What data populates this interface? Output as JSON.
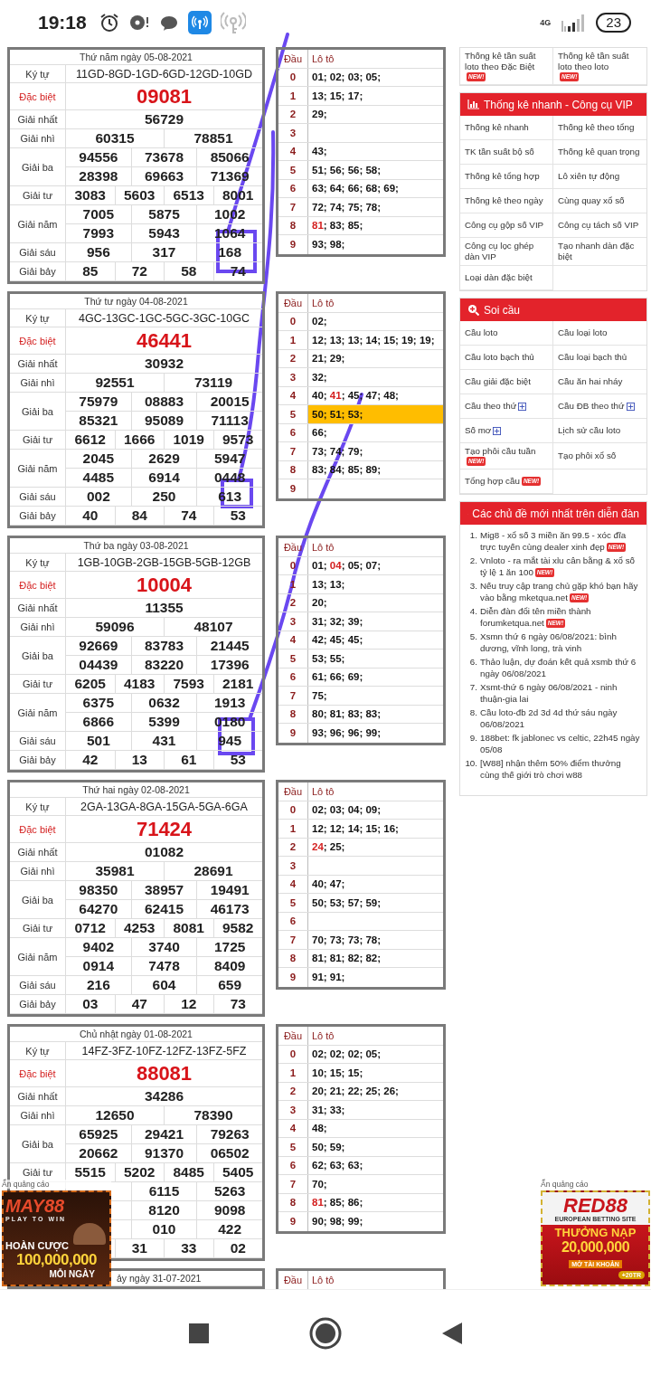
{
  "status_bar": {
    "time": "19:18",
    "network": "4G",
    "battery": "23"
  },
  "results": [
    {
      "date": "Thứ năm ngày 05-08-2021",
      "prizes": [
        {
          "kind": "code",
          "label": "Ký tự",
          "lines": [
            [
              "11GD-8GD-1GD-6GD-12GD-10GD"
            ]
          ]
        },
        {
          "kind": "special",
          "label": "Đặc biệt",
          "lines": [
            [
              "09081"
            ]
          ]
        },
        {
          "kind": "normal",
          "label": "Giải nhất",
          "lines": [
            [
              "56729"
            ]
          ]
        },
        {
          "kind": "normal",
          "label": "Giải nhì",
          "lines": [
            [
              "60315",
              "78851"
            ]
          ]
        },
        {
          "kind": "normal",
          "label": "Giải ba",
          "lines": [
            [
              "94556",
              "73678",
              "85066"
            ],
            [
              "28398",
              "69663",
              "71369"
            ]
          ]
        },
        {
          "kind": "normal",
          "label": "Giải tư",
          "lines": [
            [
              "3083",
              "5603",
              "6513",
              "8001"
            ]
          ]
        },
        {
          "kind": "normal",
          "label": "Giải năm",
          "lines": [
            [
              "7005",
              "5875",
              "1002"
            ],
            [
              "7993",
              "5943",
              "1064"
            ]
          ]
        },
        {
          "kind": "normal",
          "label": "Giải sáu",
          "lines": [
            [
              "956",
              "317",
              "168"
            ]
          ]
        },
        {
          "kind": "normal",
          "label": "Giải bảy",
          "lines": [
            [
              "85",
              "72",
              "58",
              "74"
            ]
          ]
        }
      ],
      "loto": {
        "columns": [
          "Đầu",
          "Lô tô"
        ],
        "rows": [
          {
            "head": "0",
            "text": "01; 02; 03; 05;",
            "highlighted": false
          },
          {
            "head": "1",
            "text": "13; 15; 17;",
            "highlighted": false
          },
          {
            "head": "2",
            "text": "29;",
            "highlighted": false
          },
          {
            "head": "3",
            "highlighted": false
          },
          {
            "head": "4",
            "text": "43;",
            "highlighted": false
          },
          {
            "head": "5",
            "text": "51; 56; 56; 58;",
            "highlighted": false
          },
          {
            "head": "6",
            "text": "63; 64; 66; 68; 69;",
            "highlighted": false
          },
          {
            "head": "7",
            "text": "72; 74; 75; 78;",
            "highlighted": false
          },
          {
            "head": "8",
            "segments": [
              {
                "text": "81",
                "special": true
              },
              {
                "text": "; 83; 85;",
                "special": false
              }
            ],
            "highlighted": false
          },
          {
            "head": "9",
            "text": "93; 98;",
            "highlighted": false
          }
        ]
      }
    },
    {
      "date": "Thứ tư ngày 04-08-2021",
      "prizes": [
        {
          "kind": "code",
          "label": "Ký tự",
          "lines": [
            [
              "4GC-13GC-1GC-5GC-3GC-10GC"
            ]
          ]
        },
        {
          "kind": "special",
          "label": "Đặc biệt",
          "lines": [
            [
              "46441"
            ]
          ]
        },
        {
          "kind": "normal",
          "label": "Giải nhất",
          "lines": [
            [
              "30932"
            ]
          ]
        },
        {
          "kind": "normal",
          "label": "Giải nhì",
          "lines": [
            [
              "92551",
              "73119"
            ]
          ]
        },
        {
          "kind": "normal",
          "label": "Giải ba",
          "lines": [
            [
              "75979",
              "08883",
              "20015"
            ],
            [
              "85321",
              "95089",
              "71113"
            ]
          ]
        },
        {
          "kind": "normal",
          "label": "Giải tư",
          "lines": [
            [
              "6612",
              "1666",
              "1019",
              "9573"
            ]
          ]
        },
        {
          "kind": "normal",
          "label": "Giải năm",
          "lines": [
            [
              "2045",
              "2629",
              "5947"
            ],
            [
              "4485",
              "6914",
              "0448"
            ]
          ]
        },
        {
          "kind": "normal",
          "label": "Giải sáu",
          "lines": [
            [
              "002",
              "250",
              "613"
            ]
          ]
        },
        {
          "kind": "normal",
          "label": "Giải bảy",
          "lines": [
            [
              "40",
              "84",
              "74",
              "53"
            ]
          ]
        }
      ],
      "loto": {
        "columns": [
          "Đầu",
          "Lô tô"
        ],
        "rows": [
          {
            "head": "0",
            "text": "02;",
            "highlighted": false
          },
          {
            "head": "1",
            "text": "12; 13; 13; 14; 15; 19; 19;",
            "highlighted": false
          },
          {
            "head": "2",
            "text": "21; 29;",
            "highlighted": false
          },
          {
            "head": "3",
            "text": "32;",
            "highlighted": false
          },
          {
            "head": "4",
            "segments": [
              {
                "text": "40; ",
                "special": false
              },
              {
                "text": "41",
                "special": true
              },
              {
                "text": "; 45; 47; 48;",
                "special": false
              }
            ],
            "highlighted": false
          },
          {
            "head": "5",
            "text": "50; 51; 53;",
            "highlighted": true
          },
          {
            "head": "6",
            "text": "66;",
            "highlighted": false
          },
          {
            "head": "7",
            "text": "73; 74; 79;",
            "highlighted": false
          },
          {
            "head": "8",
            "text": "83; 84; 85; 89;",
            "highlighted": false
          },
          {
            "head": "9",
            "highlighted": false
          }
        ]
      }
    },
    {
      "date": "Thứ ba ngày 03-08-2021",
      "prizes": [
        {
          "kind": "code",
          "label": "Ký tự",
          "lines": [
            [
              "1GB-10GB-2GB-15GB-5GB-12GB"
            ]
          ]
        },
        {
          "kind": "special",
          "label": "Đặc biệt",
          "lines": [
            [
              "10004"
            ]
          ]
        },
        {
          "kind": "normal",
          "label": "Giải nhất",
          "lines": [
            [
              "11355"
            ]
          ]
        },
        {
          "kind": "normal",
          "label": "Giải nhì",
          "lines": [
            [
              "59096",
              "48107"
            ]
          ]
        },
        {
          "kind": "normal",
          "label": "Giải ba",
          "lines": [
            [
              "92669",
              "83783",
              "21445"
            ],
            [
              "04439",
              "83220",
              "17396"
            ]
          ]
        },
        {
          "kind": "normal",
          "label": "Giải tư",
          "lines": [
            [
              "6205",
              "4183",
              "7593",
              "2181"
            ]
          ]
        },
        {
          "kind": "normal",
          "label": "Giải năm",
          "lines": [
            [
              "6375",
              "0632",
              "1913"
            ],
            [
              "6866",
              "5399",
              "0180"
            ]
          ]
        },
        {
          "kind": "normal",
          "label": "Giải sáu",
          "lines": [
            [
              "501",
              "431",
              "945"
            ]
          ]
        },
        {
          "kind": "normal",
          "label": "Giải bảy",
          "lines": [
            [
              "42",
              "13",
              "61",
              "53"
            ]
          ]
        }
      ],
      "loto": {
        "columns": [
          "Đầu",
          "Lô tô"
        ],
        "rows": [
          {
            "head": "0",
            "segments": [
              {
                "text": "01; ",
                "special": false
              },
              {
                "text": "04",
                "special": true
              },
              {
                "text": "; 05; 07;",
                "special": false
              }
            ],
            "highlighted": false
          },
          {
            "head": "1",
            "text": "13; 13;",
            "highlighted": false
          },
          {
            "head": "2",
            "text": "20;",
            "highlighted": false
          },
          {
            "head": "3",
            "text": "31; 32; 39;",
            "highlighted": false
          },
          {
            "head": "4",
            "text": "42; 45; 45;",
            "highlighted": false
          },
          {
            "head": "5",
            "text": "53; 55;",
            "highlighted": false
          },
          {
            "head": "6",
            "text": "61; 66; 69;",
            "highlighted": false
          },
          {
            "head": "7",
            "text": "75;",
            "highlighted": false
          },
          {
            "head": "8",
            "text": "80; 81; 83; 83;",
            "highlighted": false
          },
          {
            "head": "9",
            "text": "93; 96; 96; 99;",
            "highlighted": false
          }
        ]
      }
    },
    {
      "date": "Thứ hai ngày 02-08-2021",
      "prizes": [
        {
          "kind": "code",
          "label": "Ký tự",
          "lines": [
            [
              "2GA-13GA-8GA-15GA-5GA-6GA"
            ]
          ]
        },
        {
          "kind": "special",
          "label": "Đặc biệt",
          "lines": [
            [
              "71424"
            ]
          ]
        },
        {
          "kind": "normal",
          "label": "Giải nhất",
          "lines": [
            [
              "01082"
            ]
          ]
        },
        {
          "kind": "normal",
          "label": "Giải nhì",
          "lines": [
            [
              "35981",
              "28691"
            ]
          ]
        },
        {
          "kind": "normal",
          "label": "Giải ba",
          "lines": [
            [
              "98350",
              "38957",
              "19491"
            ],
            [
              "64270",
              "62415",
              "46173"
            ]
          ]
        },
        {
          "kind": "normal",
          "label": "Giải tư",
          "lines": [
            [
              "0712",
              "4253",
              "8081",
              "9582"
            ]
          ]
        },
        {
          "kind": "normal",
          "label": "Giải năm",
          "lines": [
            [
              "9402",
              "3740",
              "1725"
            ],
            [
              "0914",
              "7478",
              "8409"
            ]
          ]
        },
        {
          "kind": "normal",
          "label": "Giải sáu",
          "lines": [
            [
              "216",
              "604",
              "659"
            ]
          ]
        },
        {
          "kind": "normal",
          "label": "Giải bảy",
          "lines": [
            [
              "03",
              "47",
              "12",
              "73"
            ]
          ]
        }
      ],
      "loto": {
        "columns": [
          "Đầu",
          "Lô tô"
        ],
        "rows": [
          {
            "head": "0",
            "text": "02; 03; 04; 09;",
            "highlighted": false
          },
          {
            "head": "1",
            "text": "12; 12; 14; 15; 16;",
            "highlighted": false
          },
          {
            "head": "2",
            "segments": [
              {
                "text": "24",
                "special": true
              },
              {
                "text": "; 25;",
                "special": false
              }
            ],
            "highlighted": false
          },
          {
            "head": "3",
            "highlighted": false
          },
          {
            "head": "4",
            "text": "40; 47;",
            "highlighted": false
          },
          {
            "head": "5",
            "text": "50; 53; 57; 59;",
            "highlighted": false
          },
          {
            "head": "6",
            "highlighted": false
          },
          {
            "head": "7",
            "text": "70; 73; 73; 78;",
            "highlighted": false
          },
          {
            "head": "8",
            "text": "81; 81; 82; 82;",
            "highlighted": false
          },
          {
            "head": "9",
            "text": "91; 91;",
            "highlighted": false
          }
        ]
      }
    },
    {
      "date": "Chủ nhật ngày 01-08-2021",
      "prizes": [
        {
          "kind": "code",
          "label": "Ký tự",
          "lines": [
            [
              "14FZ-3FZ-10FZ-12FZ-13FZ-5FZ"
            ]
          ]
        },
        {
          "kind": "special",
          "label": "Đặc biệt",
          "lines": [
            [
              "88081"
            ]
          ]
        },
        {
          "kind": "normal",
          "label": "Giải nhất",
          "lines": [
            [
              "34286"
            ]
          ]
        },
        {
          "kind": "normal",
          "label": "Giải nhì",
          "lines": [
            [
              "12650",
              "78390"
            ]
          ]
        },
        {
          "kind": "normal",
          "label": "Giải ba",
          "lines": [
            [
              "65925",
              "29421",
              "79263"
            ],
            [
              "20662",
              "91370",
              "06502"
            ]
          ]
        },
        {
          "kind": "normal",
          "label": "Giải tư",
          "lines": [
            [
              "5515",
              "5202",
              "8485",
              "5405"
            ]
          ]
        },
        {
          "kind": "normal",
          "lines": [
            [
              "6115",
              "5263"
            ],
            [
              "8120",
              "9098"
            ]
          ],
          "leading_blank": true
        },
        {
          "kind": "normal",
          "lines": [
            [
              "010",
              "422"
            ]
          ],
          "leading_blank": true
        },
        {
          "kind": "normal",
          "lines": [
            [
              "31",
              "33",
              "02"
            ]
          ],
          "leading_blank": true
        }
      ],
      "loto": {
        "columns": [
          "Đầu",
          "Lô tô"
        ],
        "rows": [
          {
            "head": "0",
            "text": "02; 02; 02; 05;",
            "highlighted": false
          },
          {
            "head": "1",
            "text": "10; 15; 15;",
            "highlighted": false
          },
          {
            "head": "2",
            "text": "20; 21; 22; 25; 26;",
            "highlighted": false
          },
          {
            "head": "3",
            "text": "31; 33;",
            "highlighted": false
          },
          {
            "head": "4",
            "text": "48;",
            "highlighted": false
          },
          {
            "head": "5",
            "text": "50; 59;",
            "highlighted": false
          },
          {
            "head": "6",
            "text": "62; 63; 63;",
            "highlighted": false
          },
          {
            "head": "7",
            "text": "70;",
            "highlighted": false
          },
          {
            "head": "8",
            "segments": [
              {
                "text": "81",
                "special": true
              },
              {
                "text": "; 85; 86;",
                "special": false
              }
            ],
            "highlighted": false
          },
          {
            "head": "9",
            "text": "90; 98; 99;",
            "highlighted": false
          }
        ]
      }
    },
    {
      "date": "ảy ngày 31-07-2021",
      "loto": {
        "columns": [
          "Đầu",
          "Lô tô"
        ]
      }
    }
  ],
  "sidebar": {
    "top_links": [
      {
        "text": "Thống kê tần suất loto theo Đặc Biệt",
        "badge": "NEW!",
        "expandable": false
      },
      {
        "text": "Thống kê tần suất loto theo loto",
        "badge": "NEW!",
        "expandable": false
      }
    ],
    "sections": [
      {
        "kind": "stats",
        "title": "Thống kê nhanh - Công cụ VIP",
        "items": [
          {
            "text": "Thống kê nhanh",
            "expandable": false
          },
          {
            "text": "Thống kê theo tổng",
            "expandable": false
          },
          {
            "text": "TK tần suất bộ số",
            "expandable": false
          },
          {
            "text": "Thống kê quan trọng",
            "expandable": false
          },
          {
            "text": "Thống kê tổng hợp",
            "expandable": false
          },
          {
            "text": "Lô xiên tự động",
            "expandable": false
          },
          {
            "text": "Thống kê theo ngày",
            "expandable": false
          },
          {
            "text": "Cùng quay xổ số",
            "expandable": false
          },
          {
            "text": "Công cụ gộp số VIP",
            "expandable": false
          },
          {
            "text": "Công cụ tách số VIP",
            "expandable": false
          },
          {
            "text": "Công cụ lọc ghép dàn VIP",
            "expandable": false
          },
          {
            "text": "Tạo nhanh dàn đặc biệt",
            "expandable": false
          },
          {
            "text": "Loại dàn đặc biệt",
            "expandable": false
          }
        ]
      },
      {
        "kind": "bridge",
        "title": "Soi cầu",
        "items": [
          {
            "text": "Cầu loto",
            "expandable": false
          },
          {
            "text": "Cầu loại loto",
            "expandable": false
          },
          {
            "text": "Cầu loto bạch thủ",
            "expandable": false
          },
          {
            "text": "Cầu loại bạch thủ",
            "expandable": false
          },
          {
            "text": "Cầu giải đặc biệt",
            "expandable": false
          },
          {
            "text": "Cầu ăn hai nháy",
            "expandable": false
          },
          {
            "text": "Cầu theo thứ",
            "expandable": true
          },
          {
            "text": "Cầu ĐB theo thứ",
            "expandable": true
          },
          {
            "text": "Số mơ",
            "expandable": true
          },
          {
            "text": "Lịch sử cầu loto",
            "expandable": false
          },
          {
            "text": "Tạo phôi cầu tuần",
            "badge": "NEW!",
            "expandable": false
          },
          {
            "text": "Tạo phôi xổ số",
            "expandable": false
          },
          {
            "text": "Tổng hợp cầu",
            "badge": "NEW!",
            "expandable": false
          }
        ]
      }
    ],
    "forum": {
      "title": "Các chủ đề mới nhất trên diễn đàn",
      "items": [
        {
          "num": "1.",
          "text": "Mig8 - xổ số 3 miền ăn 99.5 - xóc đĩa trực tuyến cùng dealer xinh đẹp",
          "badge": "NEW!"
        },
        {
          "num": "2.",
          "text": "Vnloto - ra mắt tài xỉu cân bằng & xổ số tỷ lệ 1 ăn 100",
          "badge": "NEW!"
        },
        {
          "num": "3.",
          "text": "Nếu truy cập trang chủ gặp khó bạn hãy vào bằng mketqua.net",
          "badge": "NEW!"
        },
        {
          "num": "4.",
          "text": "Diễn đàn đổi tên miền thành forumketqua.net",
          "badge": "NEW!"
        },
        {
          "num": "5.",
          "text": "Xsmn thứ 6 ngày 06/08/2021: bình dương, vĩnh long, trà vinh"
        },
        {
          "num": "6.",
          "text": "Thảo luận, dự đoán kết quả xsmb thứ 6 ngày 06/08/2021"
        },
        {
          "num": "7.",
          "text": "Xsmt-thứ 6 ngày 06/08/2021 - ninh thuận-gia lai"
        },
        {
          "num": "8.",
          "text": "Cầu loto-đb 2d 3d 4d thứ sáu ngày 06/08/2021"
        },
        {
          "num": "9.",
          "text": "188bet: fk jablonec vs celtic, 22h45 ngày 05/08"
        },
        {
          "num": "10.",
          "text": "[W88] nhận thêm 50% điểm thưởng cùng thế giới trò chơi w88"
        }
      ]
    }
  },
  "ads": [
    {
      "kind": "left",
      "hide_label": "Ẩn quảng cáo",
      "brand": "MAY88",
      "tagline": "PLAY TO WIN",
      "headline": "HOÀN CƯỢC",
      "amount": "100,000,000",
      "footer": "MỖI NGÀY"
    },
    {
      "kind": "right",
      "hide_label": "Ẩn quảng cáo",
      "brand": "RED88",
      "tagline": "EUROPEAN BETTING SITE",
      "headline": "THƯỞNG NẠP",
      "amount": "20,000,000",
      "footer": "MỞ TÀI KHOẢN",
      "bonus": "+20TR"
    }
  ]
}
